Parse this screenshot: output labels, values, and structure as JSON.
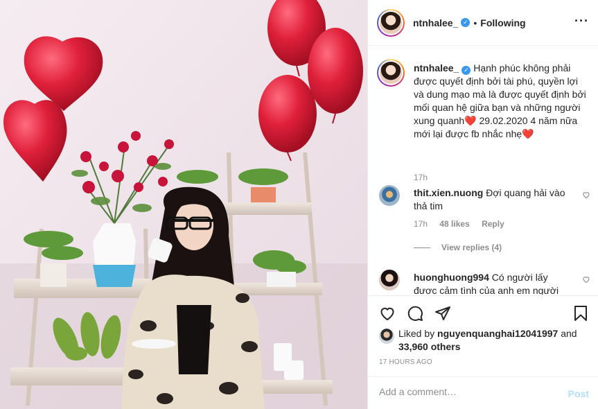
{
  "header": {
    "username": "ntnhalee_",
    "separator": "•",
    "follow_status": "Following",
    "more_icon": "more-horizontal-icon"
  },
  "caption": {
    "username": "ntnhalee_",
    "text": "Hạnh phúc không phải được quyết định bởi tài phú, quyền lợi và dung mạo mà là được quyết định bởi mối quan hệ giữa bạn và những người xung quanh❤️ 29.02.2020 4 năm nữa mới lại được fb nhắc nhẹ❤️",
    "time": "17h"
  },
  "comments": [
    {
      "username": "thit.xien.nuong",
      "text": "Đợi quang hải vào thả tim",
      "time": "17h",
      "likes": "48 likes",
      "reply_label": "Reply",
      "view_replies": "View replies (4)"
    },
    {
      "username": "huonghuong994",
      "text": "Có người lấy được cảm tình của anh em người"
    }
  ],
  "actions": {
    "like_icon": "heart-icon",
    "comment_icon": "comment-icon",
    "share_icon": "send-icon",
    "save_icon": "bookmark-icon"
  },
  "likes": {
    "prefix": "Liked by",
    "user": "nguyenquanghai12041997",
    "and": "and",
    "others": "33,960 others"
  },
  "timestamp": "17 HOURS AGO",
  "add_comment": {
    "placeholder": "Add a comment…",
    "post_label": "Post"
  },
  "colors": {
    "verified": "#3897f0",
    "post_disabled": "#b2dffc",
    "balloon_red": "#e0203a"
  }
}
